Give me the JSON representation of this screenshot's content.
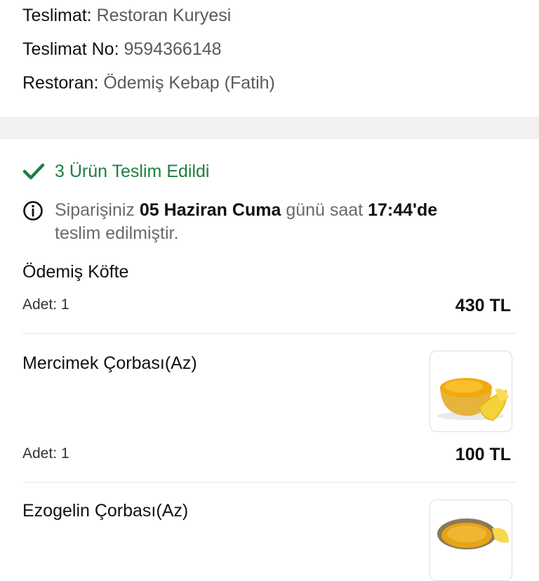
{
  "delivery_info": {
    "type_label": "Teslimat:",
    "type_value": "Restoran Kuryesi",
    "number_label": "Teslimat No:",
    "number_value": "9594366148",
    "restaurant_label": "Restoran:",
    "restaurant_value": "Ödemiş Kebap (Fatih)"
  },
  "status": {
    "delivered_text": "3 Ürün Teslim Edildi",
    "color": "#1d7f3e"
  },
  "notice": {
    "prefix": "Siparişiniz",
    "date": "05 Haziran Cuma",
    "middle": "günü saat",
    "time": "17:44'de",
    "suffix": "teslim edilmiştir."
  },
  "items": [
    {
      "name": "Ödemiş Köfte",
      "qty": "Adet: 1",
      "price": "430 TL",
      "image": null
    },
    {
      "name": "Mercimek Çorbası(Az)",
      "qty": "Adet: 1",
      "price": "100 TL",
      "image": "soup-bowl-icon"
    },
    {
      "name": "Ezogelin Çorbası(Az)",
      "image": "soup-bowl-icon"
    }
  ]
}
